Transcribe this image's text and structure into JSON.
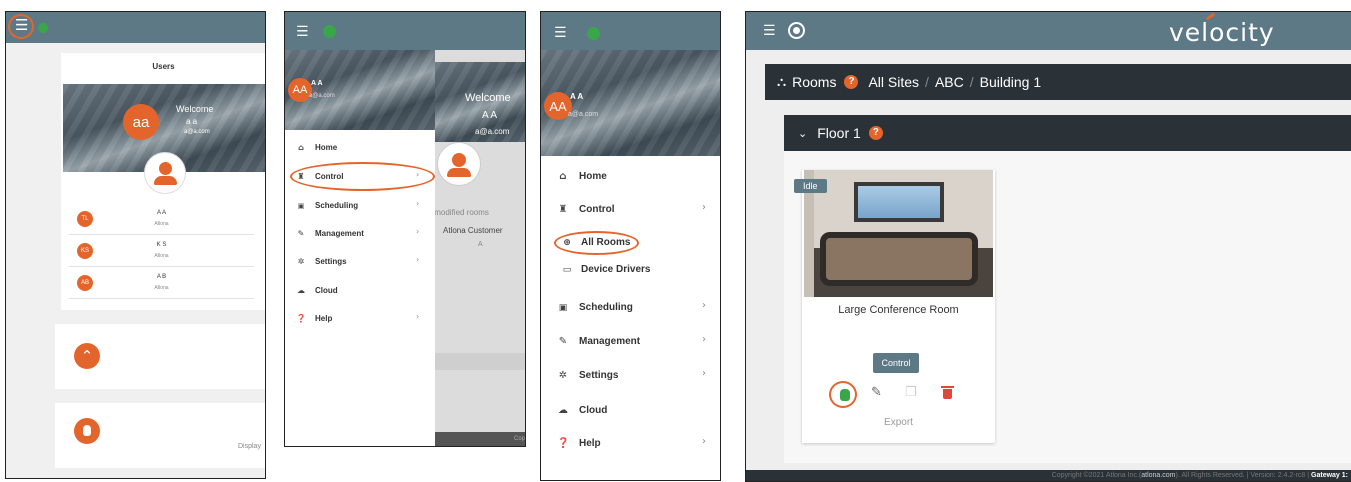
{
  "panel1": {
    "page_title": "Users",
    "welcome": "Welcome",
    "user_name": "a a",
    "user_email": "a@a.com",
    "avatar_initials": "aa",
    "users": [
      {
        "initials": "TL",
        "name": "A A",
        "org": "Atlona"
      },
      {
        "initials": "KS",
        "name": "K S",
        "org": "Atlona"
      },
      {
        "initials": "AB",
        "name": "A B",
        "org": "Atlona"
      }
    ],
    "display_text": "Display"
  },
  "panel2": {
    "avatar_initials": "AA",
    "user_name": "A A",
    "user_email": "a@a.com",
    "welcome": "Welcome",
    "welcome_name": "A A",
    "welcome_email": "a@a.com",
    "recent_text": "y modified rooms",
    "customer": "Atlona Customer",
    "customer_sub": "A",
    "footer_text": "Cop",
    "menu": [
      {
        "label": "Home",
        "icon": "home-icon"
      },
      {
        "label": "Control",
        "icon": "joystick-icon"
      },
      {
        "label": "Scheduling",
        "icon": "calendar-icon"
      },
      {
        "label": "Management",
        "icon": "wrench-icon"
      },
      {
        "label": "Settings",
        "icon": "gear-icon"
      },
      {
        "label": "Cloud",
        "icon": "cloud-icon"
      },
      {
        "label": "Help",
        "icon": "help-icon"
      }
    ]
  },
  "panel3": {
    "avatar_initials": "AA",
    "user_name": "A A",
    "user_email": "a@a.com",
    "menu": [
      {
        "label": "Home",
        "icon": "home-icon"
      },
      {
        "label": "Control",
        "icon": "joystick-icon"
      },
      {
        "label": "All Rooms",
        "icon": "globe-icon"
      },
      {
        "label": "Device Drivers",
        "icon": "device-icon"
      },
      {
        "label": "Scheduling",
        "icon": "calendar-icon"
      },
      {
        "label": "Management",
        "icon": "wrench-icon"
      },
      {
        "label": "Settings",
        "icon": "gear-icon"
      },
      {
        "label": "Cloud",
        "icon": "cloud-icon"
      },
      {
        "label": "Help",
        "icon": "help-icon"
      }
    ]
  },
  "panel4": {
    "brand": "velocity",
    "breadcrumb": {
      "section": "Rooms",
      "site": "All Sites",
      "org": "ABC",
      "building": "Building 1",
      "separator": "/"
    },
    "floor": "Floor 1",
    "room": {
      "status": "Idle",
      "name": "Large Conference Room",
      "control_label": "Control",
      "export_label": "Export"
    },
    "footer": {
      "copyright": "Copyright ©2021 Atlona Inc.(",
      "link": "atlona.com",
      "rights": "). All Rights Reserved. | Version: 2.4.2-rc8 | ",
      "gateway": "Gateway 1:"
    }
  },
  "colors": {
    "topbar": "#5e7986",
    "accent": "#e4652b",
    "dark": "#2a3238",
    "green": "#3aa64a",
    "red": "#e0463a"
  }
}
